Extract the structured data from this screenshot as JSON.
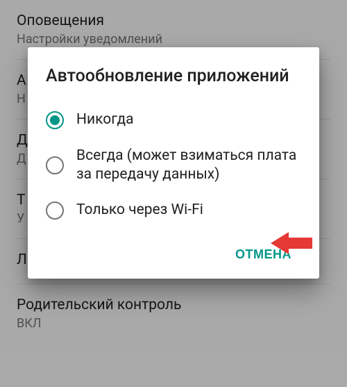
{
  "background": {
    "items": [
      {
        "title": "Оповещения",
        "subtitle": "Настройки уведомлений"
      },
      {
        "title": "А",
        "subtitle": "Н"
      },
      {
        "title": "Д",
        "subtitle": "Д"
      },
      {
        "title": "Т",
        "subtitle": "У"
      },
      {
        "title": "Л",
        "subtitle": ""
      },
      {
        "title": "Родительский контроль",
        "subtitle": "ВКЛ"
      }
    ]
  },
  "dialog": {
    "title": "Автообновление приложений",
    "options": [
      {
        "label": "Никогда",
        "selected": true
      },
      {
        "label": "Всегда (может взиматься плата за передачу данных)",
        "selected": false
      },
      {
        "label": "Только через Wi-Fi",
        "selected": false
      }
    ],
    "cancel_label": "ОТМЕНА"
  },
  "annotation": {
    "arrow_color": "#e53935"
  }
}
